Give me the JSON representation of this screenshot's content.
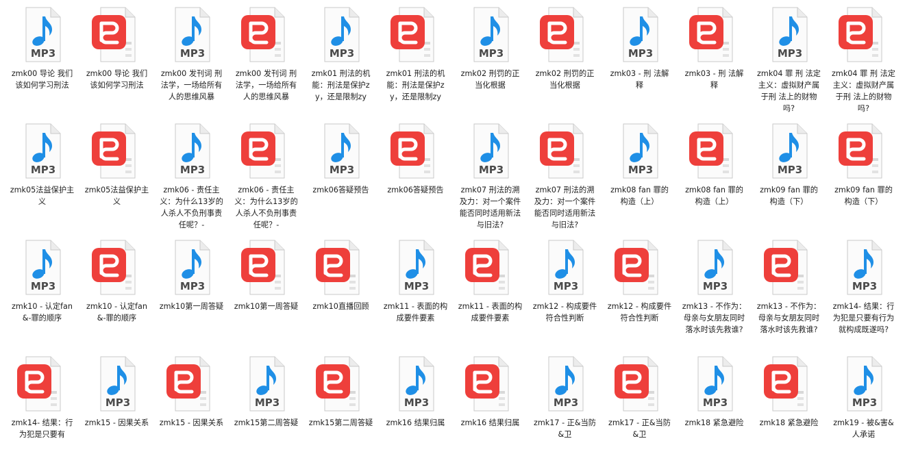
{
  "icons": {
    "mp3": {
      "name": "mp3-file-icon",
      "label": "MP3",
      "note_color": "#1f8fe6",
      "text_color": "#4b4b4b"
    },
    "pdf": {
      "name": "pdf-file-icon",
      "badge_color": "#ee3f3b"
    }
  },
  "files": [
    {
      "type": "mp3",
      "label": "zmk00 导论  我们该如何学习刑法"
    },
    {
      "type": "pdf",
      "label": "zmk00 导论  我们该如何学习刑法"
    },
    {
      "type": "mp3",
      "label": "zmk00 发刊词 刑法学，一场给所有人的思维风暴"
    },
    {
      "type": "pdf",
      "label": "zmk00 发刊词 刑法学，一场给所有人的思维风暴"
    },
    {
      "type": "mp3",
      "label": "zmk01 刑法的机能：刑法是保护zy，还是限制zy"
    },
    {
      "type": "pdf",
      "label": "zmk01 刑法的机能：刑法是保护zy，还是限制zy"
    },
    {
      "type": "mp3",
      "label": "zmk02  刑罚的正当化根据"
    },
    {
      "type": "pdf",
      "label": "zmk02  刑罚的正当化根据"
    },
    {
      "type": "mp3",
      "label": "zmk03 - 刑  法解释"
    },
    {
      "type": "pdf",
      "label": "zmk03 - 刑  法解释"
    },
    {
      "type": "mp3",
      "label": "zmk04  罪 刑 法定主义：虚拟财产属于刑  法上的财物吗?"
    },
    {
      "type": "pdf",
      "label": "zmk04  罪 刑 法定主义：虚拟财产属于刑  法上的财物吗?"
    },
    {
      "type": "mp3",
      "label": "zmk05法益保护主义"
    },
    {
      "type": "pdf",
      "label": "zmk05法益保护主义"
    },
    {
      "type": "mp3",
      "label": "zmk06 - 责任主义：为什么13岁的人杀人不负刑事责任呢？-"
    },
    {
      "type": "pdf",
      "label": "zmk06 - 责任主义：为什么13岁的人杀人不负刑事责任呢？-"
    },
    {
      "type": "mp3",
      "label": "zmk06答疑预告"
    },
    {
      "type": "pdf",
      "label": "zmk06答疑预告"
    },
    {
      "type": "mp3",
      "label": "zmk07 刑法的溯及力：对一个案件能否同时适用新法与旧法?"
    },
    {
      "type": "pdf",
      "label": "zmk07 刑法的溯及力：对一个案件能否同时适用新法与旧法?"
    },
    {
      "type": "mp3",
      "label": "zmk08 fan 罪的构造（上）"
    },
    {
      "type": "pdf",
      "label": "zmk08 fan 罪的构造（上）"
    },
    {
      "type": "mp3",
      "label": "zmk09  fan 罪的构造（下）"
    },
    {
      "type": "pdf",
      "label": "zmk09  fan 罪的构造（下）"
    },
    {
      "type": "mp3",
      "label": "zmk10 - 认定fan &-罪的顺序"
    },
    {
      "type": "pdf",
      "label": "zmk10 - 认定fan &-罪的顺序"
    },
    {
      "type": "mp3",
      "label": "zmk10第一周答疑"
    },
    {
      "type": "pdf",
      "label": "zmk10第一周答疑"
    },
    {
      "type": "pdf",
      "label": "zmk10直播回顾"
    },
    {
      "type": "mp3",
      "label": "zmk11 - 表面的构成要件要素"
    },
    {
      "type": "pdf",
      "label": "zmk11 - 表面的构成要件要素"
    },
    {
      "type": "mp3",
      "label": "zmk12 - 构成要件符合性判断"
    },
    {
      "type": "pdf",
      "label": "zmk12 - 构成要件符合性判断"
    },
    {
      "type": "mp3",
      "label": "zmk13 - 不作为：母亲与女朋友同时落水时该先救谁?"
    },
    {
      "type": "pdf",
      "label": "zmk13 - 不作为：母亲与女朋友同时落水时该先救谁?"
    },
    {
      "type": "mp3",
      "label": "zmk14- 结果：行为犯是只要有行为就构成既遂吗?"
    },
    {
      "type": "pdf",
      "label": "zmk14- 结果：行为犯是只要有"
    },
    {
      "type": "mp3",
      "label": "zmk15 - 因果关系"
    },
    {
      "type": "pdf",
      "label": "zmk15 - 因果关系"
    },
    {
      "type": "mp3",
      "label": "zmk15第二周答疑"
    },
    {
      "type": "pdf",
      "label": "zmk15第二周答疑"
    },
    {
      "type": "mp3",
      "label": "zmk16 结果归属"
    },
    {
      "type": "pdf",
      "label": "zmk16 结果归属"
    },
    {
      "type": "mp3",
      "label": "zmk17 - 正&当防&卫"
    },
    {
      "type": "pdf",
      "label": "zmk17 - 正&当防&卫"
    },
    {
      "type": "mp3",
      "label": "zmk18 紧急避险"
    },
    {
      "type": "pdf",
      "label": "zmk18 紧急避险"
    },
    {
      "type": "mp3",
      "label": "zmk19 - 被&害&人承诺"
    }
  ]
}
